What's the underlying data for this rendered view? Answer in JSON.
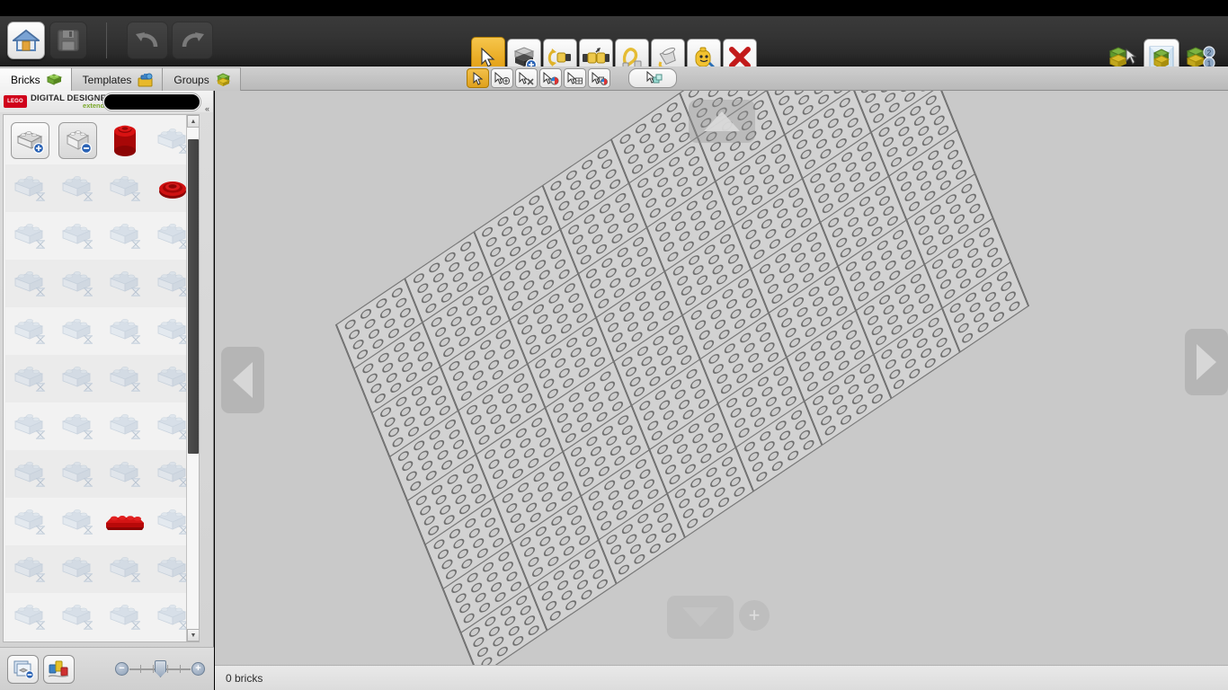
{
  "app": {
    "title": "LEGO Digital Designer",
    "logo_mark": "LEGO",
    "logo_name": "DIGITAL DESIGNER",
    "logo_edition": "extended"
  },
  "header": {
    "buttons": [
      {
        "name": "home-button",
        "label": "Home",
        "icon": "home-icon",
        "state": "enabled"
      },
      {
        "name": "save-button",
        "label": "Save",
        "icon": "floppy-disk-icon",
        "state": "disabled"
      },
      {
        "name": "undo-button",
        "label": "Undo",
        "icon": "undo-arrow-icon",
        "state": "disabled"
      },
      {
        "name": "redo-button",
        "label": "Redo",
        "icon": "redo-arrow-icon",
        "state": "disabled"
      }
    ],
    "tools": [
      {
        "name": "select-tool",
        "label": "Select",
        "icon": "cursor-arrow-icon",
        "selected": true
      },
      {
        "name": "clone-tool",
        "label": "Clone",
        "icon": "clone-brick-icon",
        "selected": false
      },
      {
        "name": "hinge-tool",
        "label": "Hinge",
        "icon": "hinge-rotate-icon",
        "selected": false
      },
      {
        "name": "hinge-align-tool",
        "label": "Hinge align",
        "icon": "hinge-align-icon",
        "selected": false
      },
      {
        "name": "flex-tool",
        "label": "Flex",
        "icon": "flex-hose-icon",
        "selected": false
      },
      {
        "name": "paint-tool",
        "label": "Paint",
        "icon": "paint-bucket-icon",
        "selected": false
      },
      {
        "name": "minifig-tool",
        "label": "Minifig paint",
        "icon": "minifig-head-icon",
        "selected": false
      },
      {
        "name": "delete-tool",
        "label": "Delete",
        "icon": "red-x-icon",
        "selected": false
      }
    ],
    "modes": [
      {
        "name": "build-mode-button",
        "label": "Build",
        "icon": "brick-cursor-icon",
        "active": false
      },
      {
        "name": "view-mode-button",
        "label": "View",
        "icon": "brick-stage-icon",
        "active": true
      },
      {
        "name": "guide-mode-button",
        "label": "Building guide",
        "icon": "brick-steps-icon",
        "active": false,
        "badges": [
          "2",
          "1"
        ]
      }
    ]
  },
  "tabs": [
    {
      "name": "tab-bricks",
      "label": "Bricks",
      "icon": "green-brick-icon",
      "active": true
    },
    {
      "name": "tab-templates",
      "label": "Templates",
      "icon": "toolbox-icon",
      "active": false
    },
    {
      "name": "tab-groups",
      "label": "Groups",
      "icon": "stacked-bricks-icon",
      "active": false
    }
  ],
  "select_toolbar": {
    "buttons": [
      {
        "name": "select-single-button",
        "label": "Select single brick",
        "icon": "cursor-arrow-icon",
        "selected": true
      },
      {
        "name": "select-connected-button",
        "label": "Select connected bricks",
        "icon": "cursor-plus-icon",
        "selected": false
      },
      {
        "name": "select-same-shape-button",
        "label": "Select bricks of same shape",
        "icon": "cursor-shape-icon",
        "selected": false
      },
      {
        "name": "select-same-color-button",
        "label": "Select bricks of same color",
        "icon": "cursor-color-icon",
        "selected": false
      },
      {
        "name": "select-same-size-button",
        "label": "Select bricks of same size",
        "icon": "cursor-grid-icon",
        "selected": false
      },
      {
        "name": "select-color-and-shape-button",
        "label": "Select same color and shape",
        "icon": "cursor-color-shape-icon",
        "selected": false
      }
    ],
    "extra_button": {
      "name": "select-all-button",
      "label": "Select all",
      "icon": "cursor-multi-brick-icon"
    }
  },
  "palette": {
    "search": {
      "name": "brick-search-input",
      "value": "",
      "placeholder": ""
    },
    "collapse_label": "«",
    "scrollbar": {
      "name": "palette-scrollbar",
      "thumb_position_pct": 2,
      "thumb_size_pct": 63
    },
    "footer": {
      "buttons": [
        {
          "name": "brick-palette-view-button",
          "label": "Palette view",
          "icon": "layers-minus-icon"
        },
        {
          "name": "color-palette-button",
          "label": "Color palette",
          "icon": "paint-cans-icon"
        }
      ],
      "zoom": {
        "name": "palette-zoom-slider",
        "minus_label": "−",
        "plus_label": "+",
        "value": 50
      }
    },
    "items": [
      {
        "name": "brick-add-item",
        "kind": "frame-add",
        "label": "Add brick"
      },
      {
        "name": "brick-remove-item",
        "kind": "frame-minus",
        "label": "Remove brick"
      },
      {
        "name": "brick-item-red-cylinder",
        "kind": "red-cylinder",
        "label": "Red cylinder brick"
      },
      {
        "name": "brick-item-ghost",
        "kind": "ghost",
        "label": "Loading brick"
      },
      {
        "name": "brick-item-ghost",
        "kind": "ghost",
        "label": "Loading brick"
      },
      {
        "name": "brick-item-ghost",
        "kind": "ghost",
        "label": "Loading brick"
      },
      {
        "name": "brick-item-ghost",
        "kind": "ghost",
        "label": "Loading brick"
      },
      {
        "name": "brick-item-red-dish",
        "kind": "red-dish",
        "label": "Red dish brick"
      },
      {
        "name": "brick-item-ghost",
        "kind": "ghost",
        "label": "Loading brick"
      },
      {
        "name": "brick-item-ghost",
        "kind": "ghost",
        "label": "Loading brick"
      },
      {
        "name": "brick-item-ghost",
        "kind": "ghost",
        "label": "Loading brick"
      },
      {
        "name": "brick-item-ghost",
        "kind": "ghost",
        "label": "Loading brick"
      },
      {
        "name": "brick-item-ghost",
        "kind": "ghost",
        "label": "Loading brick"
      },
      {
        "name": "brick-item-ghost",
        "kind": "ghost",
        "label": "Loading brick"
      },
      {
        "name": "brick-item-ghost",
        "kind": "ghost",
        "label": "Loading brick"
      },
      {
        "name": "brick-item-ghost",
        "kind": "ghost",
        "label": "Loading brick"
      },
      {
        "name": "brick-item-ghost",
        "kind": "ghost",
        "label": "Loading brick"
      },
      {
        "name": "brick-item-ghost",
        "kind": "ghost",
        "label": "Loading brick"
      },
      {
        "name": "brick-item-ghost",
        "kind": "ghost",
        "label": "Loading brick"
      },
      {
        "name": "brick-item-ghost",
        "kind": "ghost",
        "label": "Loading brick"
      },
      {
        "name": "brick-item-ghost",
        "kind": "ghost",
        "label": "Loading brick"
      },
      {
        "name": "brick-item-ghost",
        "kind": "ghost",
        "label": "Loading brick"
      },
      {
        "name": "brick-item-ghost",
        "kind": "ghost",
        "label": "Loading brick"
      },
      {
        "name": "brick-item-ghost",
        "kind": "ghost",
        "label": "Loading brick"
      },
      {
        "name": "brick-item-ghost",
        "kind": "ghost",
        "label": "Loading brick"
      },
      {
        "name": "brick-item-ghost",
        "kind": "ghost",
        "label": "Loading brick"
      },
      {
        "name": "brick-item-ghost",
        "kind": "ghost",
        "label": "Loading brick"
      },
      {
        "name": "brick-item-ghost",
        "kind": "ghost",
        "label": "Loading brick"
      },
      {
        "name": "brick-item-ghost",
        "kind": "ghost",
        "label": "Loading brick"
      },
      {
        "name": "brick-item-ghost",
        "kind": "ghost",
        "label": "Loading brick"
      },
      {
        "name": "brick-item-ghost",
        "kind": "ghost",
        "label": "Loading brick"
      },
      {
        "name": "brick-item-ghost",
        "kind": "ghost",
        "label": "Loading brick"
      },
      {
        "name": "brick-item-ghost",
        "kind": "ghost",
        "label": "Loading brick"
      },
      {
        "name": "brick-item-ghost",
        "kind": "ghost",
        "label": "Loading brick"
      },
      {
        "name": "brick-item-red-slope",
        "kind": "red-slope",
        "label": "Red slope brick"
      },
      {
        "name": "brick-item-ghost",
        "kind": "ghost",
        "label": "Loading brick"
      },
      {
        "name": "brick-item-ghost",
        "kind": "ghost",
        "label": "Loading brick"
      },
      {
        "name": "brick-item-ghost",
        "kind": "ghost",
        "label": "Loading brick"
      },
      {
        "name": "brick-item-ghost",
        "kind": "ghost",
        "label": "Loading brick"
      },
      {
        "name": "brick-item-ghost",
        "kind": "ghost",
        "label": "Loading brick"
      },
      {
        "name": "brick-item-ghost",
        "kind": "ghost",
        "label": "Loading brick"
      },
      {
        "name": "brick-item-ghost",
        "kind": "ghost",
        "label": "Loading brick"
      },
      {
        "name": "brick-item-ghost",
        "kind": "ghost",
        "label": "Loading brick"
      },
      {
        "name": "brick-item-ghost",
        "kind": "ghost",
        "label": "Loading brick"
      }
    ]
  },
  "viewport": {
    "baseplate": {
      "name": "baseplate",
      "grid_quadrants": 64,
      "studs_per_quadrant": 16
    },
    "nav": [
      {
        "name": "rotate-up-button",
        "label": "Rotate up",
        "icon": "triangle-up-icon"
      },
      {
        "name": "rotate-left-button",
        "label": "Rotate left",
        "icon": "triangle-left-icon"
      },
      {
        "name": "rotate-right-button",
        "label": "Rotate right",
        "icon": "triangle-right-icon"
      },
      {
        "name": "rotate-down-button",
        "label": "Rotate down",
        "icon": "triangle-down-icon"
      },
      {
        "name": "zoom-in-button",
        "label": "Zoom in",
        "icon": "plus-circle-icon"
      }
    ]
  },
  "statusbar": {
    "brick_count_text": "0 bricks"
  },
  "colors": {
    "accent_gold": "#e8a820",
    "brand_red": "#d0021b",
    "brand_green": "#7aa82b",
    "viewport_bg": "#c9c9c9",
    "plate": "#d2d2d2",
    "header_dark": "#343434"
  }
}
